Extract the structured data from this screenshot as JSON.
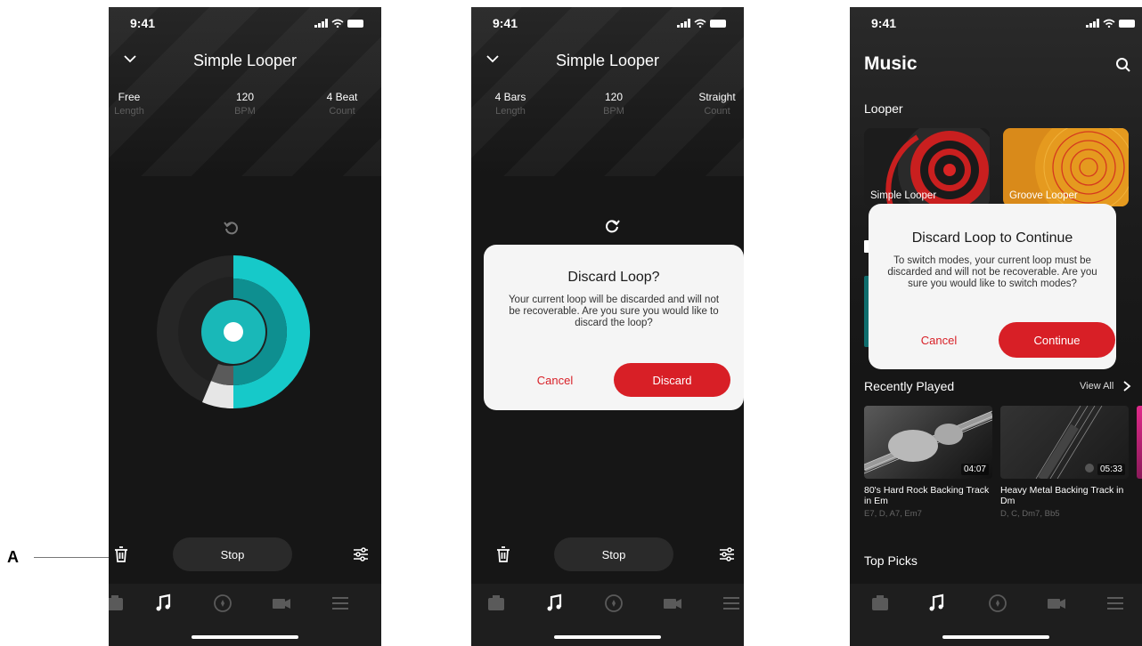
{
  "status": {
    "time": "9:41"
  },
  "screen1": {
    "title": "Simple Looper",
    "params": [
      {
        "value": "Free",
        "label": "Length"
      },
      {
        "value": "120",
        "label": "BPM"
      },
      {
        "value": "4 Beat",
        "label": "Count"
      }
    ],
    "stop_label": "Stop"
  },
  "screen2": {
    "title": "Simple Looper",
    "params": [
      {
        "value": "4 Bars",
        "label": "Length"
      },
      {
        "value": "120",
        "label": "BPM"
      },
      {
        "value": "Straight",
        "label": "Count"
      }
    ],
    "stop_label": "Stop",
    "dialog": {
      "title": "Discard Loop?",
      "message": "Your current loop will be discarded and will not be recoverable. Are you sure you would like to discard the loop?",
      "cancel": "Cancel",
      "confirm": "Discard"
    }
  },
  "screen3": {
    "title": "Music",
    "section_looper": "Looper",
    "cards": [
      {
        "label": "Simple Looper"
      },
      {
        "label": "Groove Looper"
      }
    ],
    "dialog": {
      "title": "Discard Loop to Continue",
      "message": "To switch modes, your current loop must be discarded and will not be recoverable. Are you sure you would like to switch modes?",
      "cancel": "Cancel",
      "confirm": "Continue"
    },
    "recent": {
      "heading": "Recently Played",
      "view_all": "View All",
      "tracks": [
        {
          "title": "80's Hard Rock Backing Track in Em",
          "chords": "E7, D, A7, Em7",
          "duration": "04:07"
        },
        {
          "title": "Heavy Metal Backing Track in Dm",
          "chords": "D, C, Dm7, Bb5",
          "duration": "05:33"
        }
      ]
    },
    "top_picks": "Top Picks"
  },
  "annotation": {
    "label": "A"
  },
  "colors": {
    "accent": "#d81f26",
    "cyan": "#1fd6d6",
    "background": "#161616"
  }
}
